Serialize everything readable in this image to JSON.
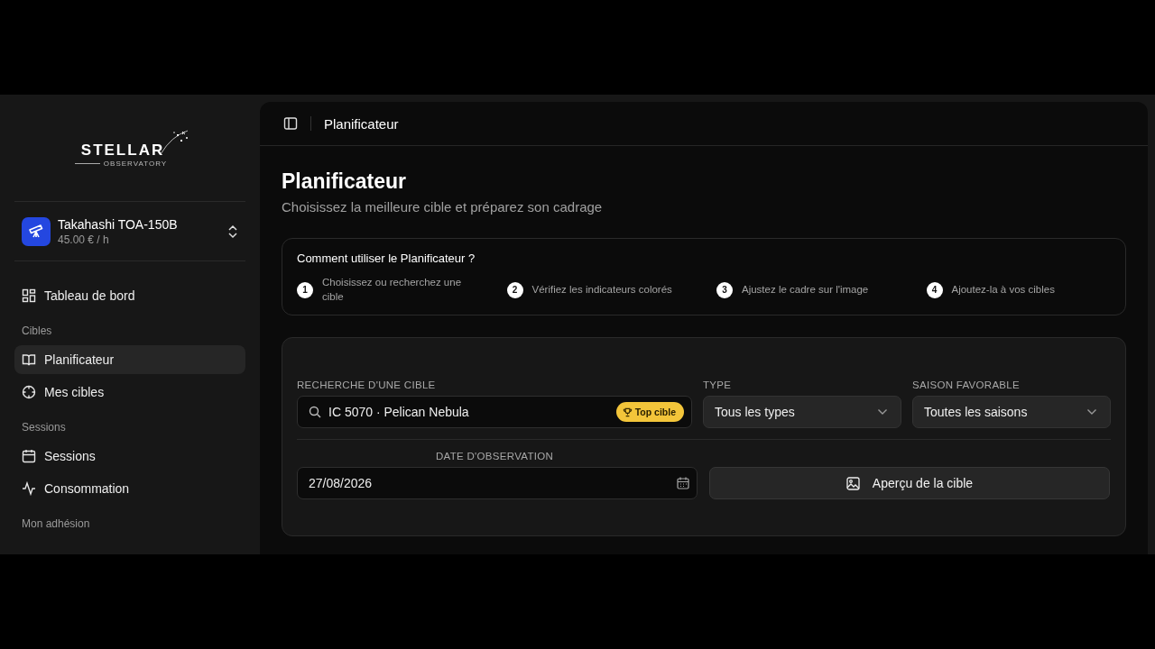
{
  "logo": {
    "name": "STELLAR",
    "tagline": "OBSERVATORY"
  },
  "telescope": {
    "name": "Takahashi TOA-150B",
    "price": "45.00 € / h"
  },
  "nav": [
    {
      "kind": "item",
      "label": "Tableau de bord",
      "selected": false
    },
    {
      "kind": "section",
      "label": "Cibles"
    },
    {
      "kind": "item",
      "label": "Planificateur",
      "selected": true
    },
    {
      "kind": "item",
      "label": "Mes cibles",
      "selected": false
    },
    {
      "kind": "section",
      "label": "Sessions"
    },
    {
      "kind": "item",
      "label": "Sessions",
      "selected": false
    },
    {
      "kind": "item",
      "label": "Consommation",
      "selected": false
    },
    {
      "kind": "section",
      "label": "Mon adhésion"
    }
  ],
  "header": {
    "title": "Planificateur"
  },
  "page": {
    "title": "Planificateur",
    "subtitle": "Choisissez la meilleure cible et préparez son cadrage"
  },
  "help": {
    "title": "Comment utiliser le Planificateur ?",
    "steps": [
      {
        "number": "1",
        "text": "Choisissez ou recherchez une cible"
      },
      {
        "number": "2",
        "text": "Vérifiez les indicateurs colorés"
      },
      {
        "number": "3",
        "text": "Ajustez le cadre sur l'image"
      },
      {
        "number": "4",
        "text": "Ajoutez-la à vos cibles"
      }
    ]
  },
  "form": {
    "search": {
      "label": "RECHERCHE D'UNE CIBLE",
      "value": "IC 5070 · Pelican Nebula",
      "badge": "Top cible"
    },
    "type": {
      "label": "TYPE",
      "value": "Tous les types"
    },
    "season": {
      "label": "SAISON FAVORABLE",
      "value": "Toutes les saisons"
    },
    "date": {
      "label": "DATE D'OBSERVATION",
      "value": "27/08/2026"
    },
    "preview_button": "Aperçu de la cible"
  }
}
